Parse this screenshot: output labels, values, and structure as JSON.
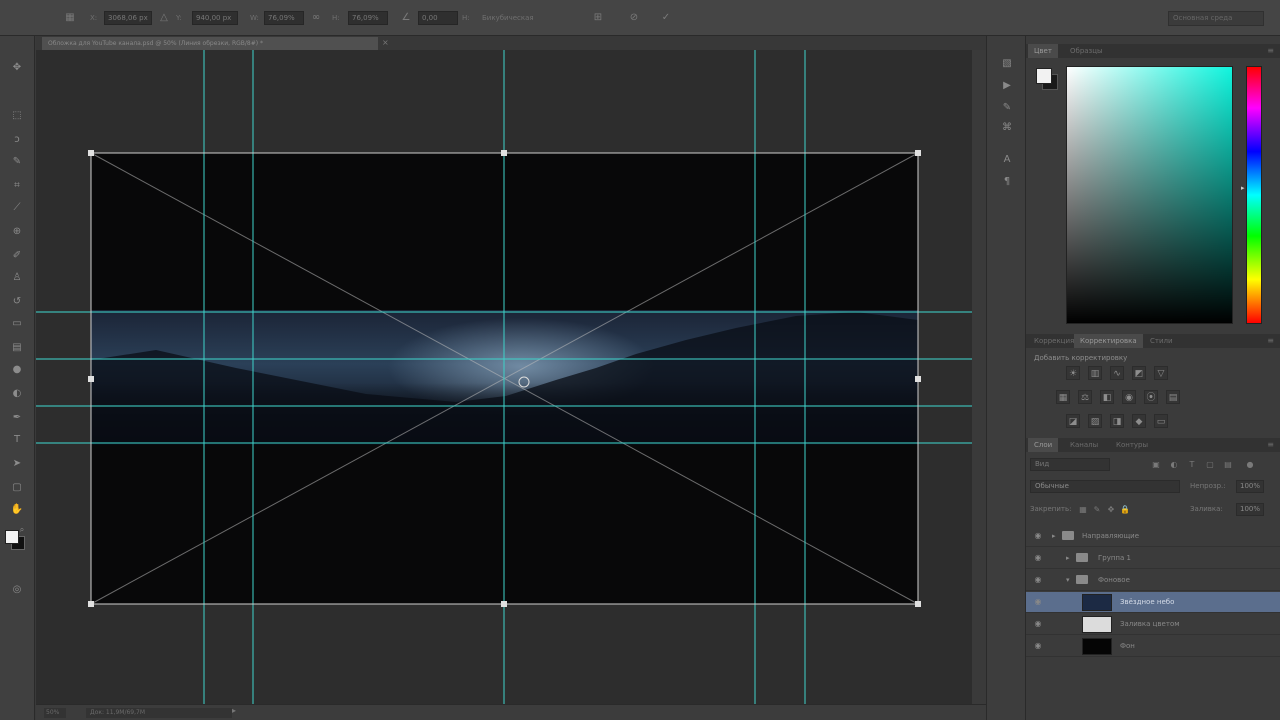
{
  "optbar": {
    "x_value": "3068,06 px",
    "y_value": "940,00 px",
    "w_value": "76,09%",
    "h_value": "76,09%",
    "angle_value": "0,00",
    "hskew_label": "H:",
    "w_label": "W:",
    "h_label": "H:",
    "interp_label": "Н:",
    "interp_value": "Бикубическая",
    "workspace": "Основная среда"
  },
  "document": {
    "tab_title": "Обложка для YouTube канала.psd @ 50% (Линия обрезки, RGB/8#) *",
    "close_glyph": "×"
  },
  "status": {
    "zoom": "50%",
    "doc_info": "Док: 11,9M/69,7M"
  },
  "color_panel": {
    "tabs": [
      "Цвет",
      "Образцы"
    ],
    "fg_color": "#f2f2f2",
    "bg_color": "#1a1a1a",
    "field_hue": "#10f5de"
  },
  "adjustments_panel": {
    "tabs": [
      "Коррекция",
      "Корректировка",
      "Стили"
    ],
    "title": "Добавить корректировку"
  },
  "layers_panel": {
    "tabs": [
      "Слои",
      "Каналы",
      "Контуры"
    ],
    "filter_label": "Вид",
    "blend_mode": "Обычные",
    "opacity_label": "Непрозр.:",
    "opacity_value": "100%",
    "lock_label": "Закрепить:",
    "fill_label": "Заливка:",
    "fill_value": "100%",
    "layers": [
      {
        "name": "Направляющие",
        "kind": "group",
        "indent": 0
      },
      {
        "name": "Группа 1",
        "kind": "group",
        "indent": 1
      },
      {
        "name": "Фоновое",
        "kind": "group",
        "indent": 1
      },
      {
        "name": "Звёздное небо",
        "kind": "image",
        "thumb": "#1c2a44",
        "selected": true
      },
      {
        "name": "Заливка цветом",
        "kind": "image",
        "thumb": "#dcdcdc"
      },
      {
        "name": "Фон",
        "kind": "image",
        "thumb": "#050505"
      }
    ]
  },
  "tools": [
    "move-tool",
    "marquee-tool",
    "lasso-tool",
    "quick-select-tool",
    "crop-tool",
    "eyedropper-tool",
    "healing-brush-tool",
    "brush-tool",
    "clone-stamp-tool",
    "history-brush-tool",
    "eraser-tool",
    "gradient-tool",
    "blur-tool",
    "dodge-tool",
    "pen-tool",
    "type-tool",
    "path-select-tool",
    "shape-tool",
    "hand-tool",
    "zoom-tool"
  ],
  "colors": {
    "guide": "#3fd0c8",
    "crop_outline": "#cfcfcf",
    "selection": "#5b6e8d"
  }
}
